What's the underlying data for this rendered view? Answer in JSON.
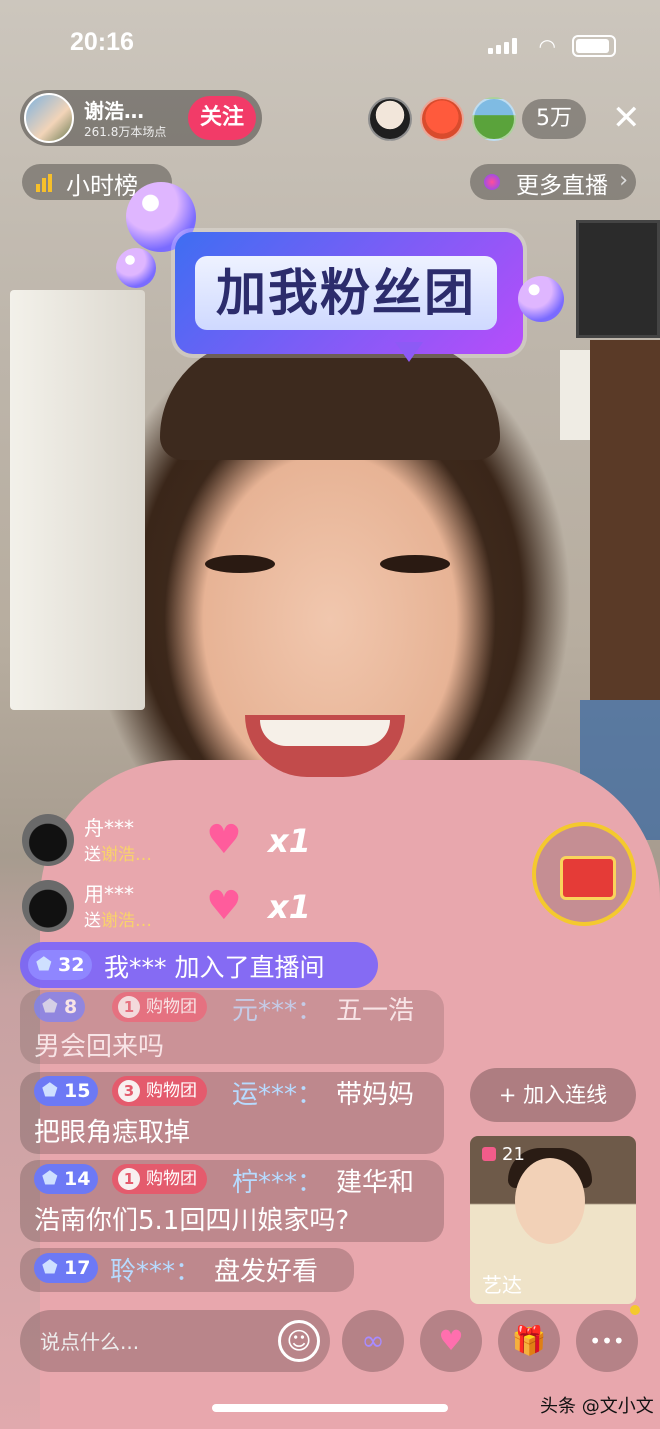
{
  "status_bar": {
    "time": "20:16"
  },
  "host": {
    "name": "谢浩…",
    "likes": "261.8万本场点",
    "follow_label": "关注"
  },
  "viewers": {
    "count": "5万",
    "close_glyph": "✕"
  },
  "rank": {
    "label": "小时榜"
  },
  "more_live": {
    "label": "更多直播",
    "chevron": "›"
  },
  "sticker": {
    "text": "加我粉丝团"
  },
  "gifts": [
    {
      "user": "舟***",
      "prefix": "送",
      "target": "谢浩…",
      "count": "x1"
    },
    {
      "user": "用***",
      "prefix": "送",
      "target": "谢浩…",
      "count": "x1"
    }
  ],
  "join": {
    "level": "32",
    "text": "我*** 加入了直播间"
  },
  "chat": [
    {
      "level": "8",
      "fan_level": "1",
      "fan_label": "购物团",
      "user": "元***：",
      "line1": "五一浩",
      "line2": "男会回来吗"
    },
    {
      "level": "15",
      "fan_level": "3",
      "fan_label": "购物团",
      "user": "运***：",
      "line1": "带妈妈",
      "line2": "把眼角痣取掉"
    },
    {
      "level": "14",
      "fan_level": "1",
      "fan_label": "购物团",
      "user": "柠***：",
      "line1": "建华和",
      "line2": "浩南你们5.1回四川娘家吗?"
    },
    {
      "level": "17",
      "user": "聆***：",
      "line1": "盘发好看"
    }
  ],
  "connect": {
    "label": "+ 加入连线"
  },
  "pip": {
    "count": "21",
    "name": "艺达"
  },
  "bottom_bar": {
    "placeholder": "说点什么...",
    "emoji": "☺",
    "link": "∞",
    "heart": "♥",
    "gift": "🎁",
    "more": "•••"
  },
  "watermark": "头条 @文小文"
}
